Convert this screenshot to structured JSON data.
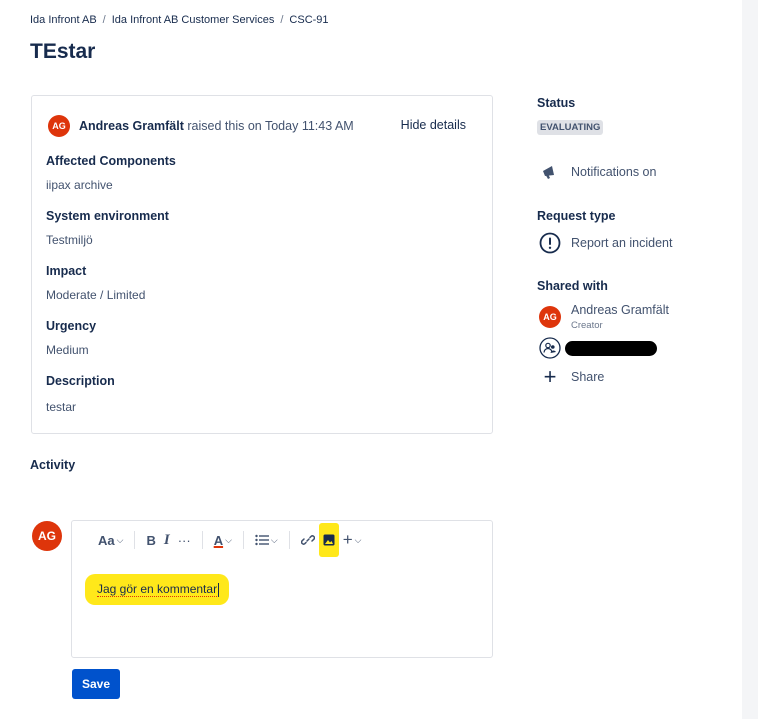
{
  "breadcrumb": {
    "item1": "Ida Infront AB",
    "sep": "/",
    "item2": "Ida Infront AB Customer Services",
    "item3": "CSC-91"
  },
  "issue": {
    "title": "TEstar"
  },
  "details": {
    "avatar_initials": "AG",
    "reporter": "Andreas Gramfält",
    "raised_text": "raised this on Today 11:43 AM",
    "hide_label": "Hide details",
    "fields": [
      {
        "label": "Affected Components",
        "value": "iipax archive"
      },
      {
        "label": "System environment",
        "value": "Testmiljö"
      },
      {
        "label": "Impact",
        "value": "Moderate / Limited"
      },
      {
        "label": "Urgency",
        "value": "Medium"
      },
      {
        "label": "Description",
        "value": "testar"
      }
    ]
  },
  "activity": {
    "label": "Activity"
  },
  "comment": {
    "avatar_initials": "AG",
    "toolbar": {
      "text_style": "Aa",
      "bold": "B",
      "italic": "I",
      "more": "···",
      "text_color": "A"
    },
    "text": "Jag gör en kommentar",
    "save_label": "Save"
  },
  "sidebar": {
    "status_label": "Status",
    "status_value": "EVALUATING",
    "notifications": "Notifications on",
    "request_type_label": "Request type",
    "request_type_value": "Report an incident",
    "shared_with_label": "Shared with",
    "shared_user_initials": "AG",
    "shared_user_name": "Andreas Gramfält",
    "shared_user_role": "Creator",
    "share_label": "Share"
  },
  "colors": {
    "accent": "#0052cc",
    "avatar": "#de350b",
    "highlight": "#ffe81a",
    "text": "#172b4d"
  }
}
